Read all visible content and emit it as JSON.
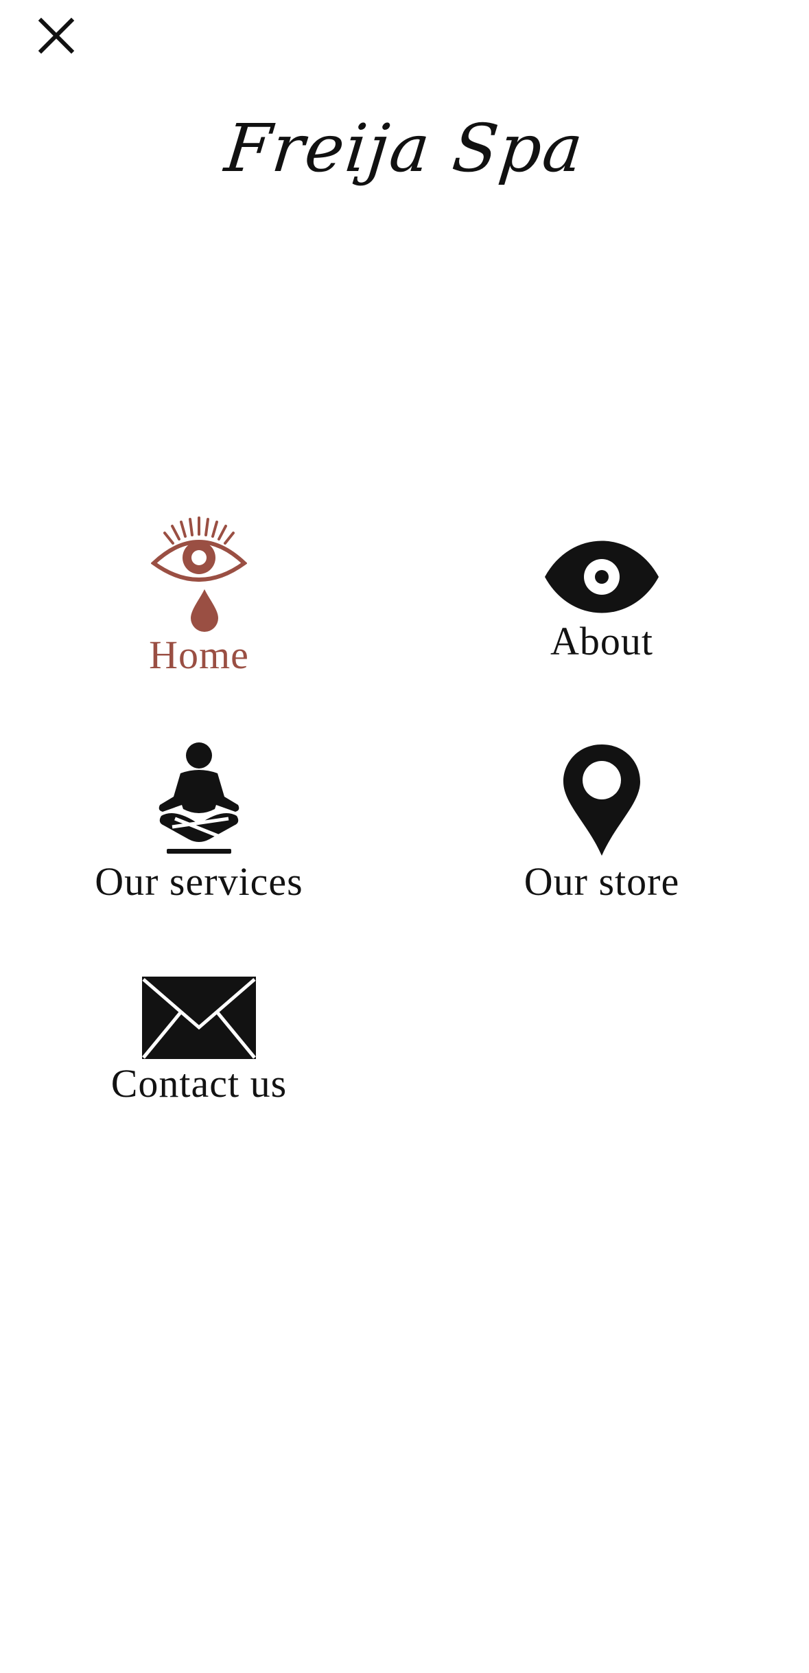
{
  "brand": {
    "name": "Freija Spa"
  },
  "colors": {
    "accent": "#9a4f43",
    "icon": "#121212",
    "background": "#ffffff"
  },
  "close": {
    "icon": "close-icon"
  },
  "menu": {
    "items": [
      {
        "id": "home",
        "label": "Home",
        "icon": "crying-eye-icon",
        "active": true
      },
      {
        "id": "about",
        "label": "About",
        "icon": "eye-icon",
        "active": false
      },
      {
        "id": "services",
        "label": "Our services",
        "icon": "meditation-icon",
        "active": false
      },
      {
        "id": "store",
        "label": "Our store",
        "icon": "map-pin-icon",
        "active": false
      },
      {
        "id": "contact",
        "label": "Contact us",
        "icon": "envelope-icon",
        "active": false
      }
    ]
  }
}
